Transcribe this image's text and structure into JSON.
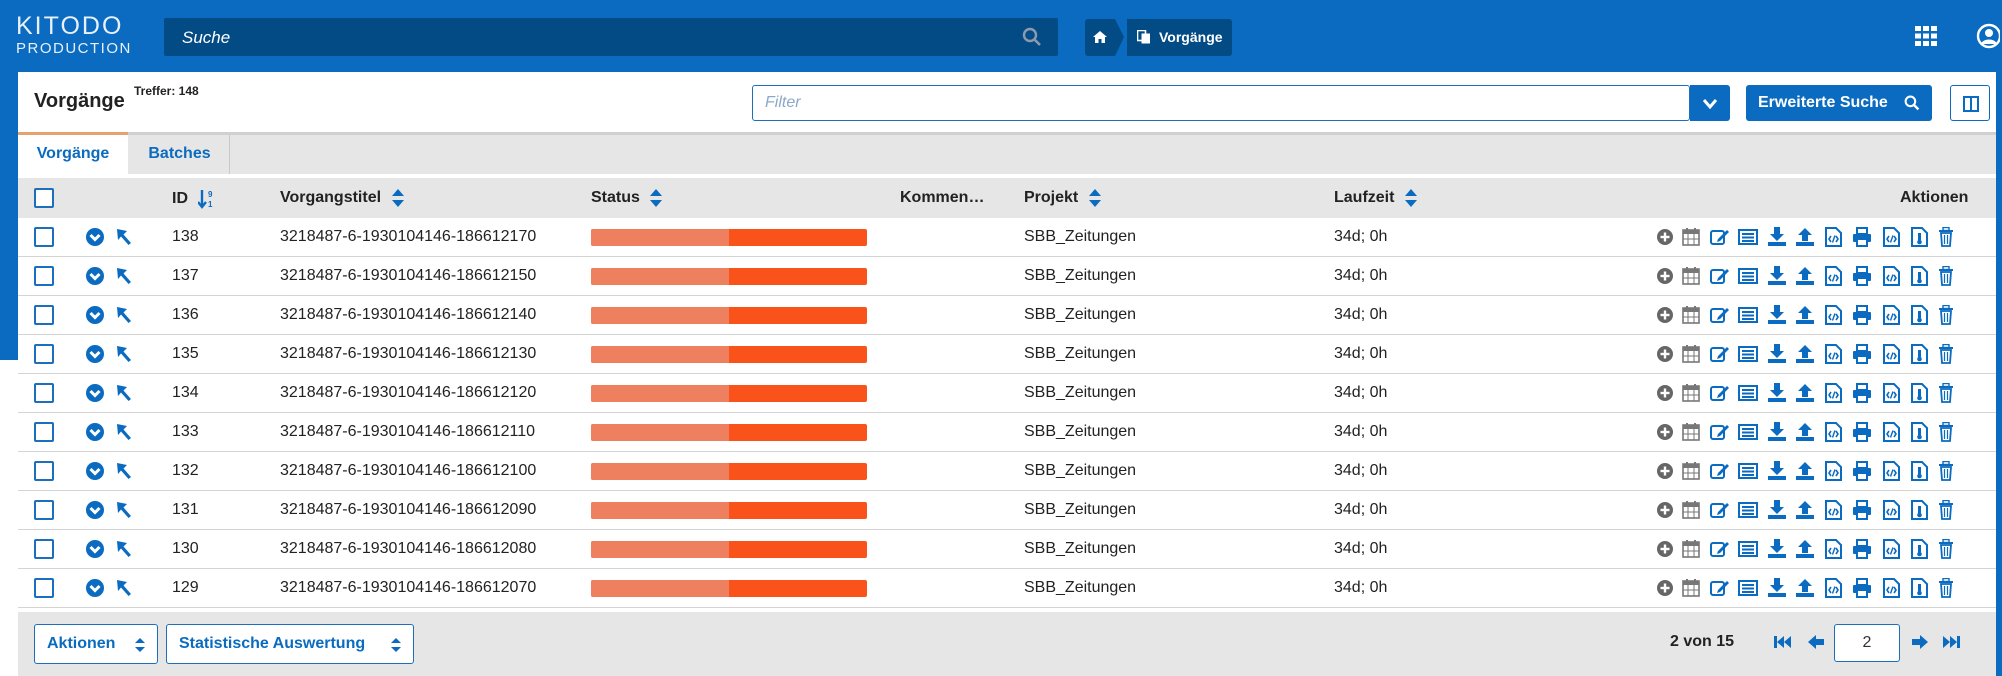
{
  "header": {
    "logo_line1": "KITODO",
    "logo_line2": "PRODUCTION",
    "search_placeholder": "Suche",
    "breadcrumb_current": "Vorgänge"
  },
  "page": {
    "title": "Vorgänge",
    "hits": "Treffer: 148",
    "filter_placeholder": "Filter",
    "advanced_search_label": "Erweiterte Suche"
  },
  "tabs": [
    {
      "label": "Vorgänge",
      "active": true
    },
    {
      "label": "Batches",
      "active": false
    }
  ],
  "table": {
    "headers": {
      "id": "ID",
      "title": "Vorgangstitel",
      "status": "Status",
      "comments": "Kommen…",
      "project": "Projekt",
      "duration": "Laufzeit",
      "actions": "Aktionen"
    },
    "rows": [
      {
        "id": "138",
        "title": "3218487-6-1930104146-186612170",
        "project": "SBB_Zeitungen",
        "duration": "34d; 0h",
        "status_done": 0.5
      },
      {
        "id": "137",
        "title": "3218487-6-1930104146-186612150",
        "project": "SBB_Zeitungen",
        "duration": "34d; 0h",
        "status_done": 0.5
      },
      {
        "id": "136",
        "title": "3218487-6-1930104146-186612140",
        "project": "SBB_Zeitungen",
        "duration": "34d; 0h",
        "status_done": 0.5
      },
      {
        "id": "135",
        "title": "3218487-6-1930104146-186612130",
        "project": "SBB_Zeitungen",
        "duration": "34d; 0h",
        "status_done": 0.5
      },
      {
        "id": "134",
        "title": "3218487-6-1930104146-186612120",
        "project": "SBB_Zeitungen",
        "duration": "34d; 0h",
        "status_done": 0.5
      },
      {
        "id": "133",
        "title": "3218487-6-1930104146-186612110",
        "project": "SBB_Zeitungen",
        "duration": "34d; 0h",
        "status_done": 0.5
      },
      {
        "id": "132",
        "title": "3218487-6-1930104146-186612100",
        "project": "SBB_Zeitungen",
        "duration": "34d; 0h",
        "status_done": 0.5
      },
      {
        "id": "131",
        "title": "3218487-6-1930104146-186612090",
        "project": "SBB_Zeitungen",
        "duration": "34d; 0h",
        "status_done": 0.5
      },
      {
        "id": "130",
        "title": "3218487-6-1930104146-186612080",
        "project": "SBB_Zeitungen",
        "duration": "34d; 0h",
        "status_done": 0.5
      },
      {
        "id": "129",
        "title": "3218487-6-1930104146-186612070",
        "project": "SBB_Zeitungen",
        "duration": "34d; 0h",
        "status_done": 0.5
      }
    ],
    "row_actions": [
      "add-circle-icon",
      "calendar-icon",
      "edit-icon",
      "list-icon",
      "download-icon",
      "upload-icon",
      "file-code-icon",
      "print-icon",
      "file-code-alt-icon",
      "file-export-icon",
      "trash-icon"
    ]
  },
  "footer": {
    "actions_label": "Aktionen",
    "statistics_label": "Statistische Auswertung",
    "page_info": "2 von 15",
    "page_input_value": "2"
  },
  "colors": {
    "primary": "#0a6bc0",
    "header_dark": "#034b85",
    "status_done": "#ee8060",
    "status_open": "#f9521b"
  }
}
